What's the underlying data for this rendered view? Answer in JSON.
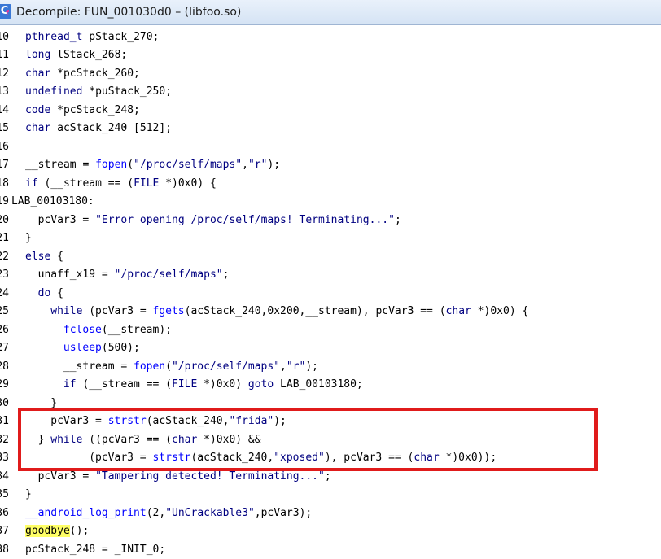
{
  "window": {
    "title": "Decompile: FUN_001030d0 – (libfoo.so)",
    "icon": "decompiler-app-icon",
    "icon_glyph": "C",
    "icon_mark": "f"
  },
  "highlight": {
    "color": "#e01b1b",
    "covers_lines": [
      "31",
      "32",
      "33"
    ]
  },
  "lines": [
    {
      "num": "10",
      "indent": 1,
      "tokens": [
        [
          "kw",
          "pthread_t"
        ],
        [
          "t",
          " pStack_270;"
        ]
      ]
    },
    {
      "num": "11",
      "indent": 1,
      "tokens": [
        [
          "kw",
          "long"
        ],
        [
          "t",
          " lStack_268;"
        ]
      ]
    },
    {
      "num": "12",
      "indent": 1,
      "tokens": [
        [
          "kw",
          "char"
        ],
        [
          "t",
          " *pcStack_260;"
        ]
      ]
    },
    {
      "num": "13",
      "indent": 1,
      "tokens": [
        [
          "kw",
          "undefined"
        ],
        [
          "t",
          " *puStack_250;"
        ]
      ]
    },
    {
      "num": "14",
      "indent": 1,
      "tokens": [
        [
          "kw",
          "code"
        ],
        [
          "t",
          " *pcStack_248;"
        ]
      ]
    },
    {
      "num": "15",
      "indent": 1,
      "tokens": [
        [
          "kw",
          "char"
        ],
        [
          "t",
          " acStack_240 [512];"
        ]
      ]
    },
    {
      "num": "16",
      "indent": 0,
      "tokens": []
    },
    {
      "num": "17",
      "indent": 1,
      "tokens": [
        [
          "t",
          "__stream = "
        ],
        [
          "fn",
          "fopen"
        ],
        [
          "t",
          "("
        ],
        [
          "str",
          "\"/proc/self/maps\""
        ],
        [
          "t",
          ","
        ],
        [
          "str",
          "\"r\""
        ],
        [
          "t",
          ");"
        ]
      ]
    },
    {
      "num": "18",
      "indent": 1,
      "tokens": [
        [
          "kw",
          "if"
        ],
        [
          "t",
          " (__stream == ("
        ],
        [
          "kw",
          "FILE"
        ],
        [
          "t",
          " *)0x0) {"
        ]
      ]
    },
    {
      "num": "19",
      "indent": 0,
      "tokens": [
        [
          "t",
          "LAB_00103180:"
        ]
      ]
    },
    {
      "num": "20",
      "indent": 2,
      "tokens": [
        [
          "t",
          "pcVar3 = "
        ],
        [
          "str",
          "\"Error opening /proc/self/maps! Terminating...\""
        ],
        [
          "t",
          ";"
        ]
      ]
    },
    {
      "num": "21",
      "indent": 1,
      "tokens": [
        [
          "t",
          "}"
        ]
      ]
    },
    {
      "num": "22",
      "indent": 1,
      "tokens": [
        [
          "kw",
          "else"
        ],
        [
          "t",
          " {"
        ]
      ]
    },
    {
      "num": "23",
      "indent": 2,
      "tokens": [
        [
          "t",
          "unaff_x19 = "
        ],
        [
          "str",
          "\"/proc/self/maps\""
        ],
        [
          "t",
          ";"
        ]
      ]
    },
    {
      "num": "24",
      "indent": 2,
      "tokens": [
        [
          "kw",
          "do"
        ],
        [
          "t",
          " {"
        ]
      ]
    },
    {
      "num": "25",
      "indent": 3,
      "tokens": [
        [
          "kw",
          "while"
        ],
        [
          "t",
          " (pcVar3 = "
        ],
        [
          "fn",
          "fgets"
        ],
        [
          "t",
          "(acStack_240,0x200,__stream), pcVar3 == ("
        ],
        [
          "kw",
          "char"
        ],
        [
          "t",
          " *)0x0) {"
        ]
      ]
    },
    {
      "num": "26",
      "indent": 4,
      "tokens": [
        [
          "fn",
          "fclose"
        ],
        [
          "t",
          "(__stream);"
        ]
      ]
    },
    {
      "num": "27",
      "indent": 4,
      "tokens": [
        [
          "fn",
          "usleep"
        ],
        [
          "t",
          "(500);"
        ]
      ]
    },
    {
      "num": "28",
      "indent": 4,
      "tokens": [
        [
          "t",
          "__stream = "
        ],
        [
          "fn",
          "fopen"
        ],
        [
          "t",
          "("
        ],
        [
          "str",
          "\"/proc/self/maps\""
        ],
        [
          "t",
          ","
        ],
        [
          "str",
          "\"r\""
        ],
        [
          "t",
          ");"
        ]
      ]
    },
    {
      "num": "29",
      "indent": 4,
      "tokens": [
        [
          "kw",
          "if"
        ],
        [
          "t",
          " (__stream == ("
        ],
        [
          "kw",
          "FILE"
        ],
        [
          "t",
          " *)0x0) "
        ],
        [
          "kw",
          "goto"
        ],
        [
          "t",
          " LAB_00103180;"
        ]
      ]
    },
    {
      "num": "30",
      "indent": 3,
      "tokens": [
        [
          "t",
          "}"
        ]
      ]
    },
    {
      "num": "31",
      "indent": 3,
      "tokens": [
        [
          "t",
          "pcVar3 = "
        ],
        [
          "fn",
          "strstr"
        ],
        [
          "t",
          "(acStack_240,"
        ],
        [
          "str",
          "\"frida\""
        ],
        [
          "t",
          ");"
        ]
      ]
    },
    {
      "num": "32",
      "indent": 2,
      "tokens": [
        [
          "t",
          "} "
        ],
        [
          "kw",
          "while"
        ],
        [
          "t",
          " ((pcVar3 == ("
        ],
        [
          "kw",
          "char"
        ],
        [
          "t",
          " *)0x0) &&"
        ]
      ]
    },
    {
      "num": "33",
      "indent": 6,
      "tokens": [
        [
          "t",
          "(pcVar3 = "
        ],
        [
          "fn",
          "strstr"
        ],
        [
          "t",
          "(acStack_240,"
        ],
        [
          "str",
          "\"xposed\""
        ],
        [
          "t",
          "), pcVar3 == ("
        ],
        [
          "kw",
          "char"
        ],
        [
          "t",
          " *)0x0));"
        ]
      ]
    },
    {
      "num": "34",
      "indent": 2,
      "tokens": [
        [
          "t",
          "pcVar3 = "
        ],
        [
          "str",
          "\"Tampering detected! Terminating...\""
        ],
        [
          "t",
          ";"
        ]
      ]
    },
    {
      "num": "35",
      "indent": 1,
      "tokens": [
        [
          "t",
          "}"
        ]
      ]
    },
    {
      "num": "36",
      "indent": 1,
      "tokens": [
        [
          "fn",
          "__android_log_print"
        ],
        [
          "t",
          "(2,"
        ],
        [
          "str",
          "\"UnCrackable3\""
        ],
        [
          "t",
          ",pcVar3);"
        ]
      ]
    },
    {
      "num": "37",
      "indent": 1,
      "tokens": [
        [
          "hl",
          "goodbye"
        ],
        [
          "t",
          "();"
        ]
      ]
    },
    {
      "num": "38",
      "indent": 1,
      "tokens": [
        [
          "t",
          "pcStack_248 = _INIT_0;"
        ]
      ]
    }
  ]
}
